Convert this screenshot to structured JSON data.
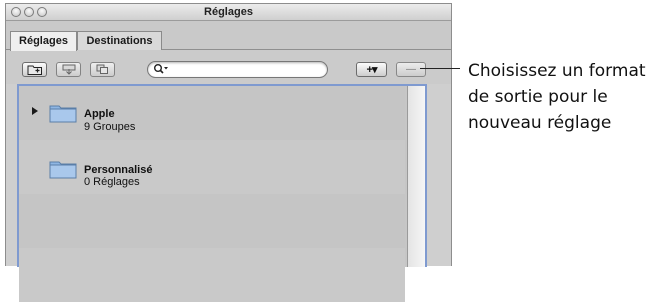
{
  "window": {
    "title": "Réglages"
  },
  "tabs": [
    {
      "label": "Réglages",
      "active": true
    },
    {
      "label": "Destinations",
      "active": false
    }
  ],
  "toolbar": {
    "search_placeholder": "",
    "add_button_label": "+▾",
    "remove_button_label": "—"
  },
  "list": {
    "items": [
      {
        "name": "Apple",
        "detail": "9 Groupes",
        "expandable": true
      },
      {
        "name": "Personnalisé",
        "detail": "0 Réglages",
        "expandable": false
      }
    ]
  },
  "callout": {
    "text": "Choisissez un format de sortie pour le nouveau réglage"
  },
  "colors": {
    "selection_border": "#7f9ad0",
    "window_bg": "#cfcfcf",
    "folder": "#8fb6e3"
  }
}
